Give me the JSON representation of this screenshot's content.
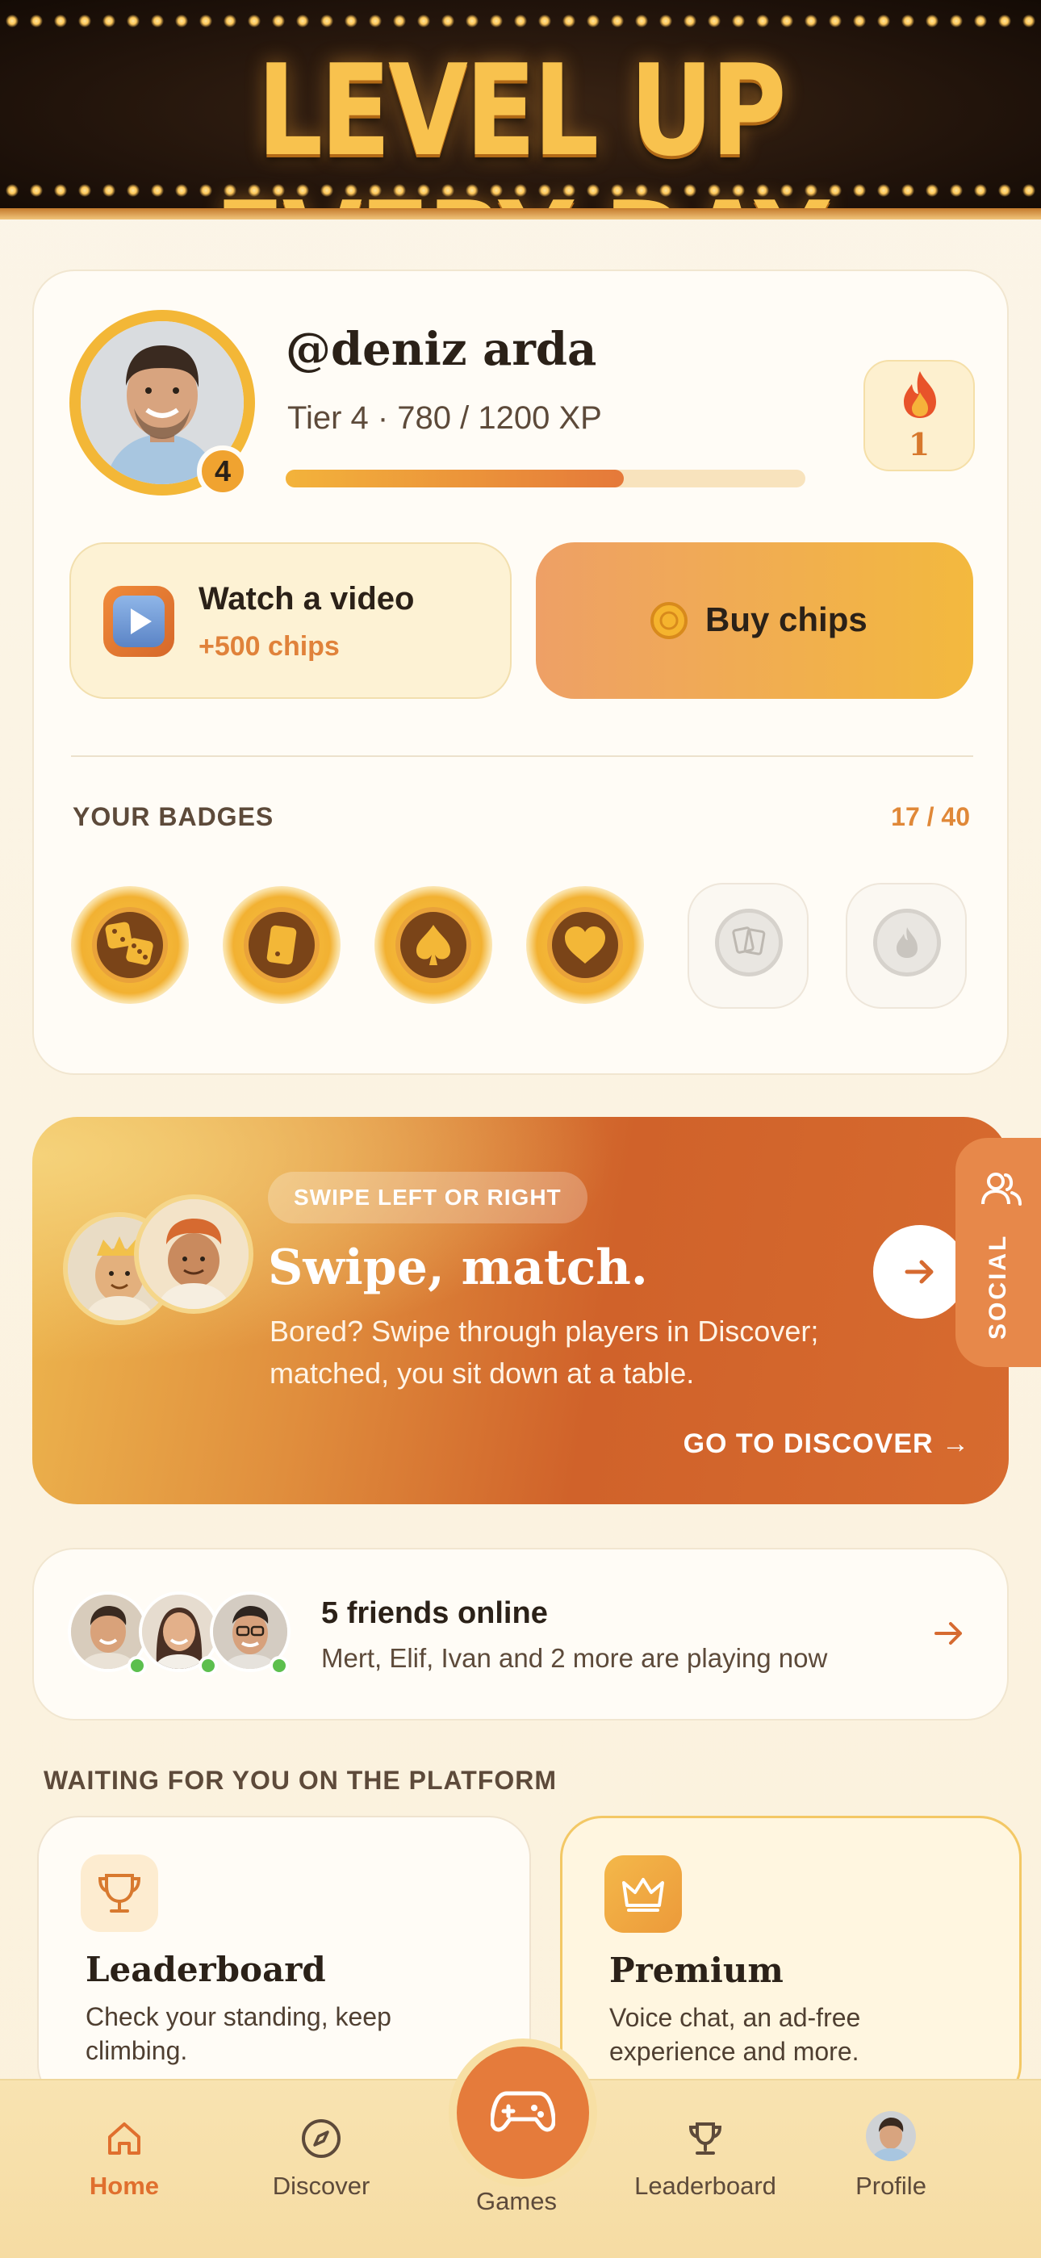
{
  "banner": {
    "title": "LEVEL UP EVERY DAY"
  },
  "profile": {
    "username": "@deniz arda",
    "tier_badge": "4",
    "tier_line": "Tier 4 · 780 / 1200 XP",
    "xp_progress": 0.65,
    "streak_count": "1",
    "streak_icon": "flame-icon"
  },
  "actions": {
    "video_label": "Watch a video",
    "video_reward": "+500 chips",
    "buy_label": "Buy chips"
  },
  "badges": {
    "title": "YOUR BADGES",
    "count": "17 / 40",
    "items": [
      {
        "icon": "dice-icon",
        "earned": true
      },
      {
        "icon": "card-icon",
        "earned": true
      },
      {
        "icon": "spade-icon",
        "earned": true
      },
      {
        "icon": "heart-icon",
        "earned": true
      },
      {
        "icon": "cards-icon",
        "earned": false
      },
      {
        "icon": "flame-icon",
        "earned": false
      }
    ]
  },
  "swipe": {
    "tag": "SWIPE LEFT OR RIGHT",
    "title": "Swipe, match.",
    "body": "Bored? Swipe through players in Discover; matched, you sit down at a table.",
    "link": "GO TO DISCOVER →"
  },
  "social_tab": {
    "label": "SOCIAL"
  },
  "friends": {
    "title": "5 friends online",
    "subtitle": "Mert, Elif, Ivan and 2 more are playing now"
  },
  "platform": {
    "section_title": "WAITING FOR YOU ON THE PLATFORM",
    "leaderboard": {
      "title": "Leaderboard",
      "desc": "Check your standing, keep climbing."
    },
    "premium": {
      "title": "Premium",
      "desc": "Voice chat, an ad-free experience and more."
    }
  },
  "nav": {
    "home": "Home",
    "discover": "Discover",
    "games": "Games",
    "leaderboard": "Leaderboard",
    "profile": "Profile",
    "active": "home"
  },
  "colors": {
    "accent": "#e57b3b",
    "gold": "#f3b737",
    "online": "#5cbf4e"
  }
}
